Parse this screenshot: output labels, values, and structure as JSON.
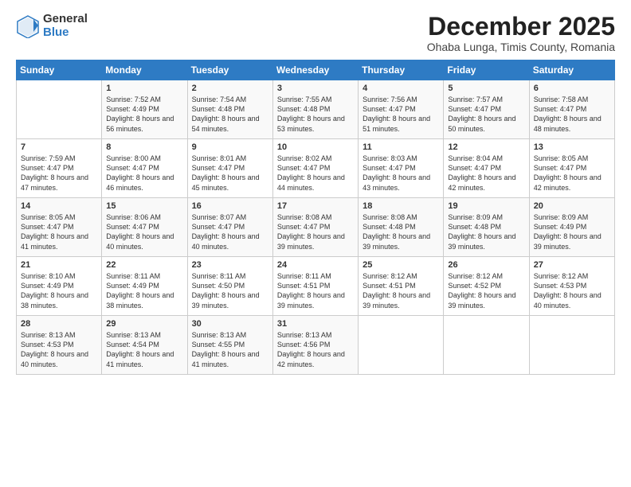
{
  "header": {
    "logo_general": "General",
    "logo_blue": "Blue",
    "month_title": "December 2025",
    "subtitle": "Ohaba Lunga, Timis County, Romania"
  },
  "calendar": {
    "days_of_week": [
      "Sunday",
      "Monday",
      "Tuesday",
      "Wednesday",
      "Thursday",
      "Friday",
      "Saturday"
    ],
    "weeks": [
      [
        {
          "day": "",
          "sunrise": "",
          "sunset": "",
          "daylight": ""
        },
        {
          "day": "1",
          "sunrise": "Sunrise: 7:52 AM",
          "sunset": "Sunset: 4:49 PM",
          "daylight": "Daylight: 8 hours and 56 minutes."
        },
        {
          "day": "2",
          "sunrise": "Sunrise: 7:54 AM",
          "sunset": "Sunset: 4:48 PM",
          "daylight": "Daylight: 8 hours and 54 minutes."
        },
        {
          "day": "3",
          "sunrise": "Sunrise: 7:55 AM",
          "sunset": "Sunset: 4:48 PM",
          "daylight": "Daylight: 8 hours and 53 minutes."
        },
        {
          "day": "4",
          "sunrise": "Sunrise: 7:56 AM",
          "sunset": "Sunset: 4:47 PM",
          "daylight": "Daylight: 8 hours and 51 minutes."
        },
        {
          "day": "5",
          "sunrise": "Sunrise: 7:57 AM",
          "sunset": "Sunset: 4:47 PM",
          "daylight": "Daylight: 8 hours and 50 minutes."
        },
        {
          "day": "6",
          "sunrise": "Sunrise: 7:58 AM",
          "sunset": "Sunset: 4:47 PM",
          "daylight": "Daylight: 8 hours and 48 minutes."
        }
      ],
      [
        {
          "day": "7",
          "sunrise": "Sunrise: 7:59 AM",
          "sunset": "Sunset: 4:47 PM",
          "daylight": "Daylight: 8 hours and 47 minutes."
        },
        {
          "day": "8",
          "sunrise": "Sunrise: 8:00 AM",
          "sunset": "Sunset: 4:47 PM",
          "daylight": "Daylight: 8 hours and 46 minutes."
        },
        {
          "day": "9",
          "sunrise": "Sunrise: 8:01 AM",
          "sunset": "Sunset: 4:47 PM",
          "daylight": "Daylight: 8 hours and 45 minutes."
        },
        {
          "day": "10",
          "sunrise": "Sunrise: 8:02 AM",
          "sunset": "Sunset: 4:47 PM",
          "daylight": "Daylight: 8 hours and 44 minutes."
        },
        {
          "day": "11",
          "sunrise": "Sunrise: 8:03 AM",
          "sunset": "Sunset: 4:47 PM",
          "daylight": "Daylight: 8 hours and 43 minutes."
        },
        {
          "day": "12",
          "sunrise": "Sunrise: 8:04 AM",
          "sunset": "Sunset: 4:47 PM",
          "daylight": "Daylight: 8 hours and 42 minutes."
        },
        {
          "day": "13",
          "sunrise": "Sunrise: 8:05 AM",
          "sunset": "Sunset: 4:47 PM",
          "daylight": "Daylight: 8 hours and 42 minutes."
        }
      ],
      [
        {
          "day": "14",
          "sunrise": "Sunrise: 8:05 AM",
          "sunset": "Sunset: 4:47 PM",
          "daylight": "Daylight: 8 hours and 41 minutes."
        },
        {
          "day": "15",
          "sunrise": "Sunrise: 8:06 AM",
          "sunset": "Sunset: 4:47 PM",
          "daylight": "Daylight: 8 hours and 40 minutes."
        },
        {
          "day": "16",
          "sunrise": "Sunrise: 8:07 AM",
          "sunset": "Sunset: 4:47 PM",
          "daylight": "Daylight: 8 hours and 40 minutes."
        },
        {
          "day": "17",
          "sunrise": "Sunrise: 8:08 AM",
          "sunset": "Sunset: 4:47 PM",
          "daylight": "Daylight: 8 hours and 39 minutes."
        },
        {
          "day": "18",
          "sunrise": "Sunrise: 8:08 AM",
          "sunset": "Sunset: 4:48 PM",
          "daylight": "Daylight: 8 hours and 39 minutes."
        },
        {
          "day": "19",
          "sunrise": "Sunrise: 8:09 AM",
          "sunset": "Sunset: 4:48 PM",
          "daylight": "Daylight: 8 hours and 39 minutes."
        },
        {
          "day": "20",
          "sunrise": "Sunrise: 8:09 AM",
          "sunset": "Sunset: 4:49 PM",
          "daylight": "Daylight: 8 hours and 39 minutes."
        }
      ],
      [
        {
          "day": "21",
          "sunrise": "Sunrise: 8:10 AM",
          "sunset": "Sunset: 4:49 PM",
          "daylight": "Daylight: 8 hours and 38 minutes."
        },
        {
          "day": "22",
          "sunrise": "Sunrise: 8:11 AM",
          "sunset": "Sunset: 4:49 PM",
          "daylight": "Daylight: 8 hours and 38 minutes."
        },
        {
          "day": "23",
          "sunrise": "Sunrise: 8:11 AM",
          "sunset": "Sunset: 4:50 PM",
          "daylight": "Daylight: 8 hours and 39 minutes."
        },
        {
          "day": "24",
          "sunrise": "Sunrise: 8:11 AM",
          "sunset": "Sunset: 4:51 PM",
          "daylight": "Daylight: 8 hours and 39 minutes."
        },
        {
          "day": "25",
          "sunrise": "Sunrise: 8:12 AM",
          "sunset": "Sunset: 4:51 PM",
          "daylight": "Daylight: 8 hours and 39 minutes."
        },
        {
          "day": "26",
          "sunrise": "Sunrise: 8:12 AM",
          "sunset": "Sunset: 4:52 PM",
          "daylight": "Daylight: 8 hours and 39 minutes."
        },
        {
          "day": "27",
          "sunrise": "Sunrise: 8:12 AM",
          "sunset": "Sunset: 4:53 PM",
          "daylight": "Daylight: 8 hours and 40 minutes."
        }
      ],
      [
        {
          "day": "28",
          "sunrise": "Sunrise: 8:13 AM",
          "sunset": "Sunset: 4:53 PM",
          "daylight": "Daylight: 8 hours and 40 minutes."
        },
        {
          "day": "29",
          "sunrise": "Sunrise: 8:13 AM",
          "sunset": "Sunset: 4:54 PM",
          "daylight": "Daylight: 8 hours and 41 minutes."
        },
        {
          "day": "30",
          "sunrise": "Sunrise: 8:13 AM",
          "sunset": "Sunset: 4:55 PM",
          "daylight": "Daylight: 8 hours and 41 minutes."
        },
        {
          "day": "31",
          "sunrise": "Sunrise: 8:13 AM",
          "sunset": "Sunset: 4:56 PM",
          "daylight": "Daylight: 8 hours and 42 minutes."
        },
        {
          "day": "",
          "sunrise": "",
          "sunset": "",
          "daylight": ""
        },
        {
          "day": "",
          "sunrise": "",
          "sunset": "",
          "daylight": ""
        },
        {
          "day": "",
          "sunrise": "",
          "sunset": "",
          "daylight": ""
        }
      ]
    ]
  }
}
